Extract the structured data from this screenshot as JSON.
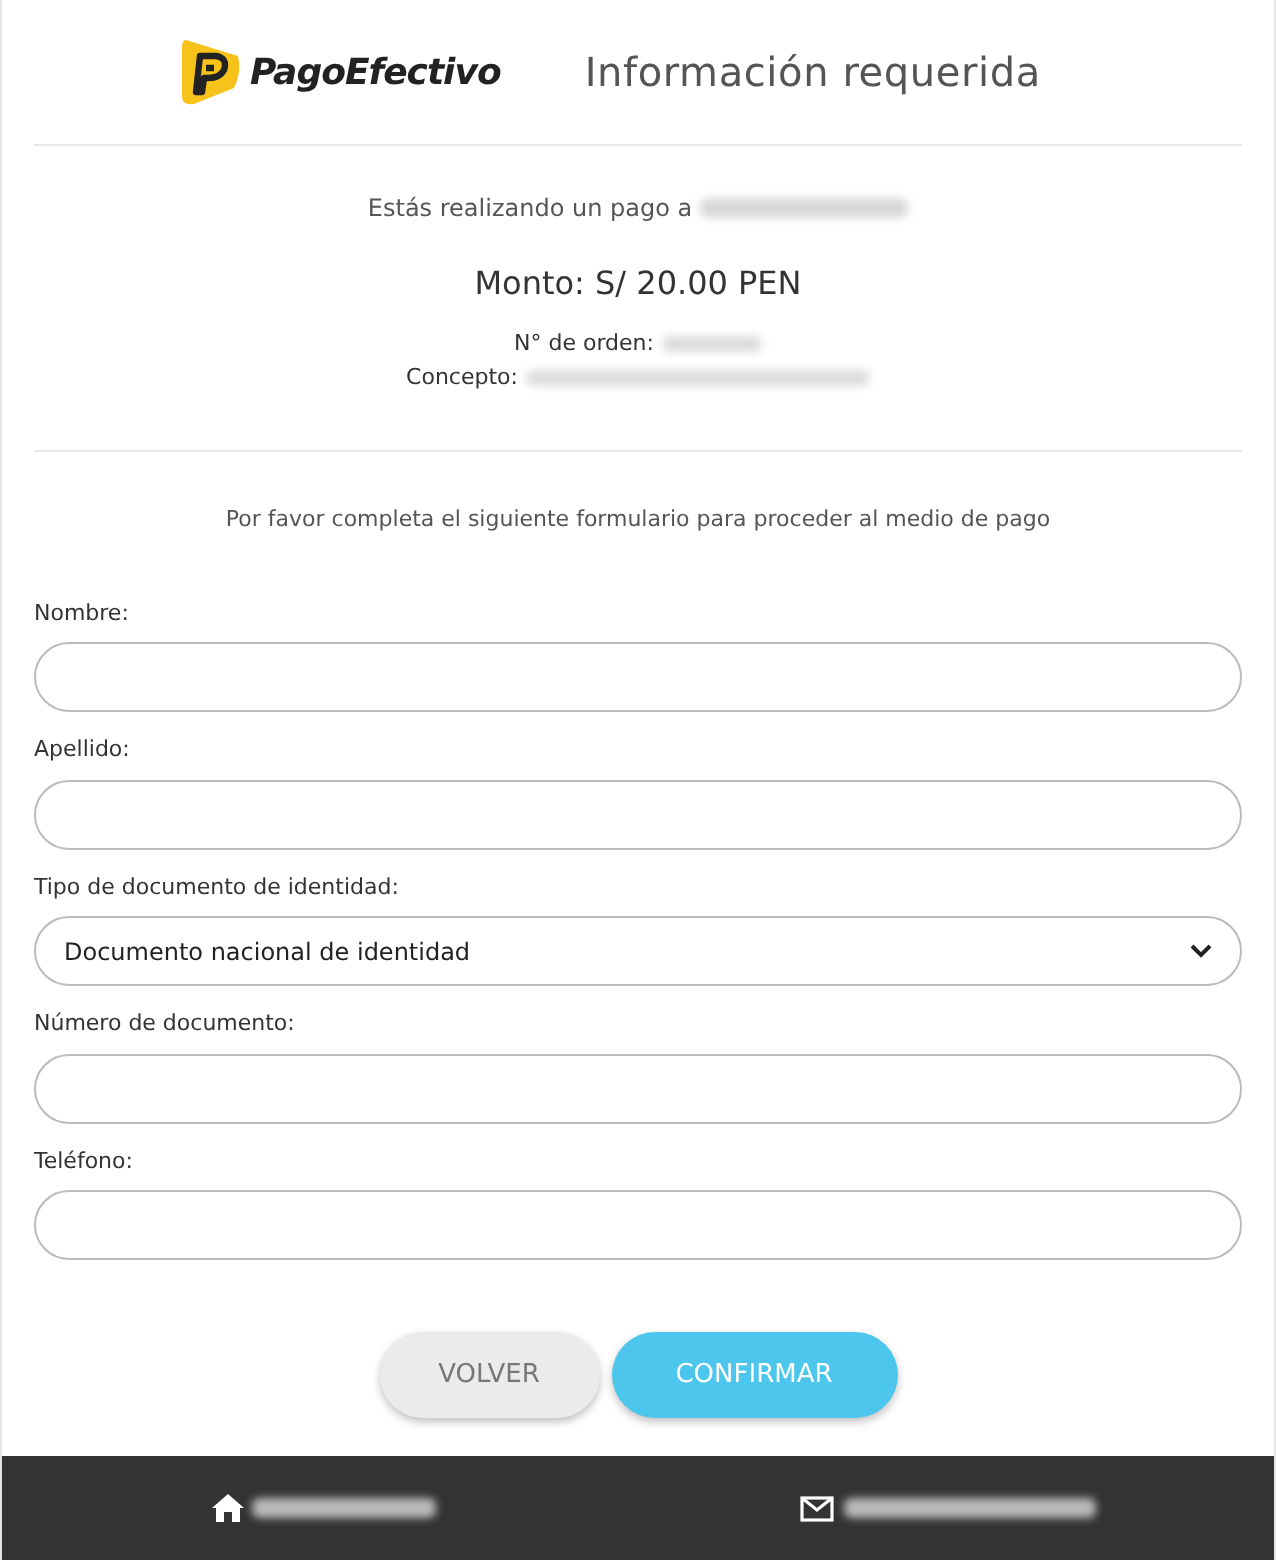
{
  "header": {
    "logo_text": "PagoEfectivo",
    "title": "Información requerida"
  },
  "payment": {
    "paying_to_label": "Estás realizando un pago a",
    "amount": "Monto: S/ 20.00 PEN",
    "order_label": "N° de orden:",
    "concept_label": "Concepto:"
  },
  "instructions": "Por favor completa el siguiente formulario para proceder al medio de pago",
  "fields": [
    {
      "kind": "text",
      "label": "Nombre:"
    },
    {
      "kind": "text",
      "label": "Apellido:"
    },
    {
      "kind": "select",
      "label": "Tipo de documento de identidad:",
      "value": "Documento nacional de identidad"
    },
    {
      "kind": "text",
      "label": "Número de documento:"
    },
    {
      "kind": "text",
      "label": "Teléfono:"
    }
  ],
  "buttons": [
    {
      "label": "VOLVER",
      "kind": "secondary"
    },
    {
      "label": "CONFIRMAR",
      "kind": "primary"
    }
  ]
}
